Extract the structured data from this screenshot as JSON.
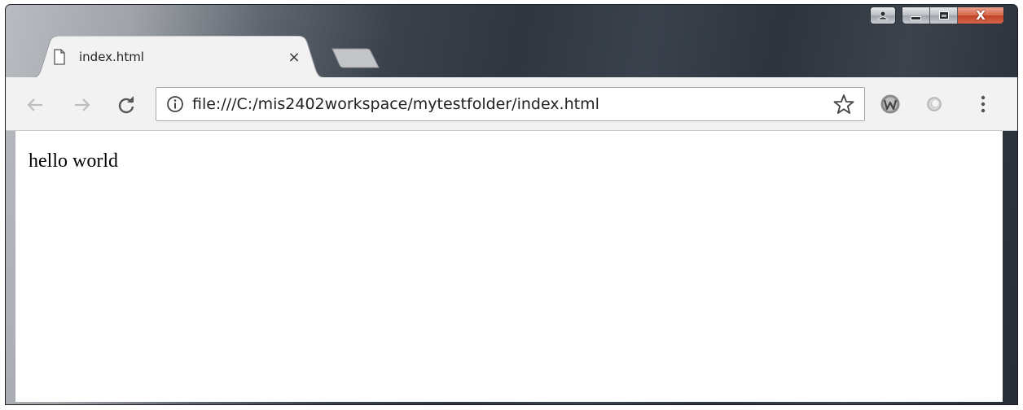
{
  "browser": {
    "tab": {
      "title": "index.html",
      "close_glyph": "×"
    },
    "address_bar": {
      "url": "file:///C:/mis2402workspace/mytestfolder/index.html"
    },
    "window_controls": {
      "close_glyph": "X"
    },
    "icons": {
      "back": "arrow-left-icon",
      "forward": "arrow-right-icon",
      "reload": "reload-icon",
      "info": "info-icon",
      "bookmark": "star-icon",
      "extension1": "w-extension-icon",
      "extension2": "circle-extension-icon",
      "menu": "kebab-menu-icon",
      "page": "page-icon",
      "user": "user-icon"
    }
  },
  "page": {
    "body_text": "hello world"
  },
  "colors": {
    "toolbar_bg": "#f2f2f2",
    "close_button": "#c9452a",
    "frame_dark": "#2f363f"
  }
}
